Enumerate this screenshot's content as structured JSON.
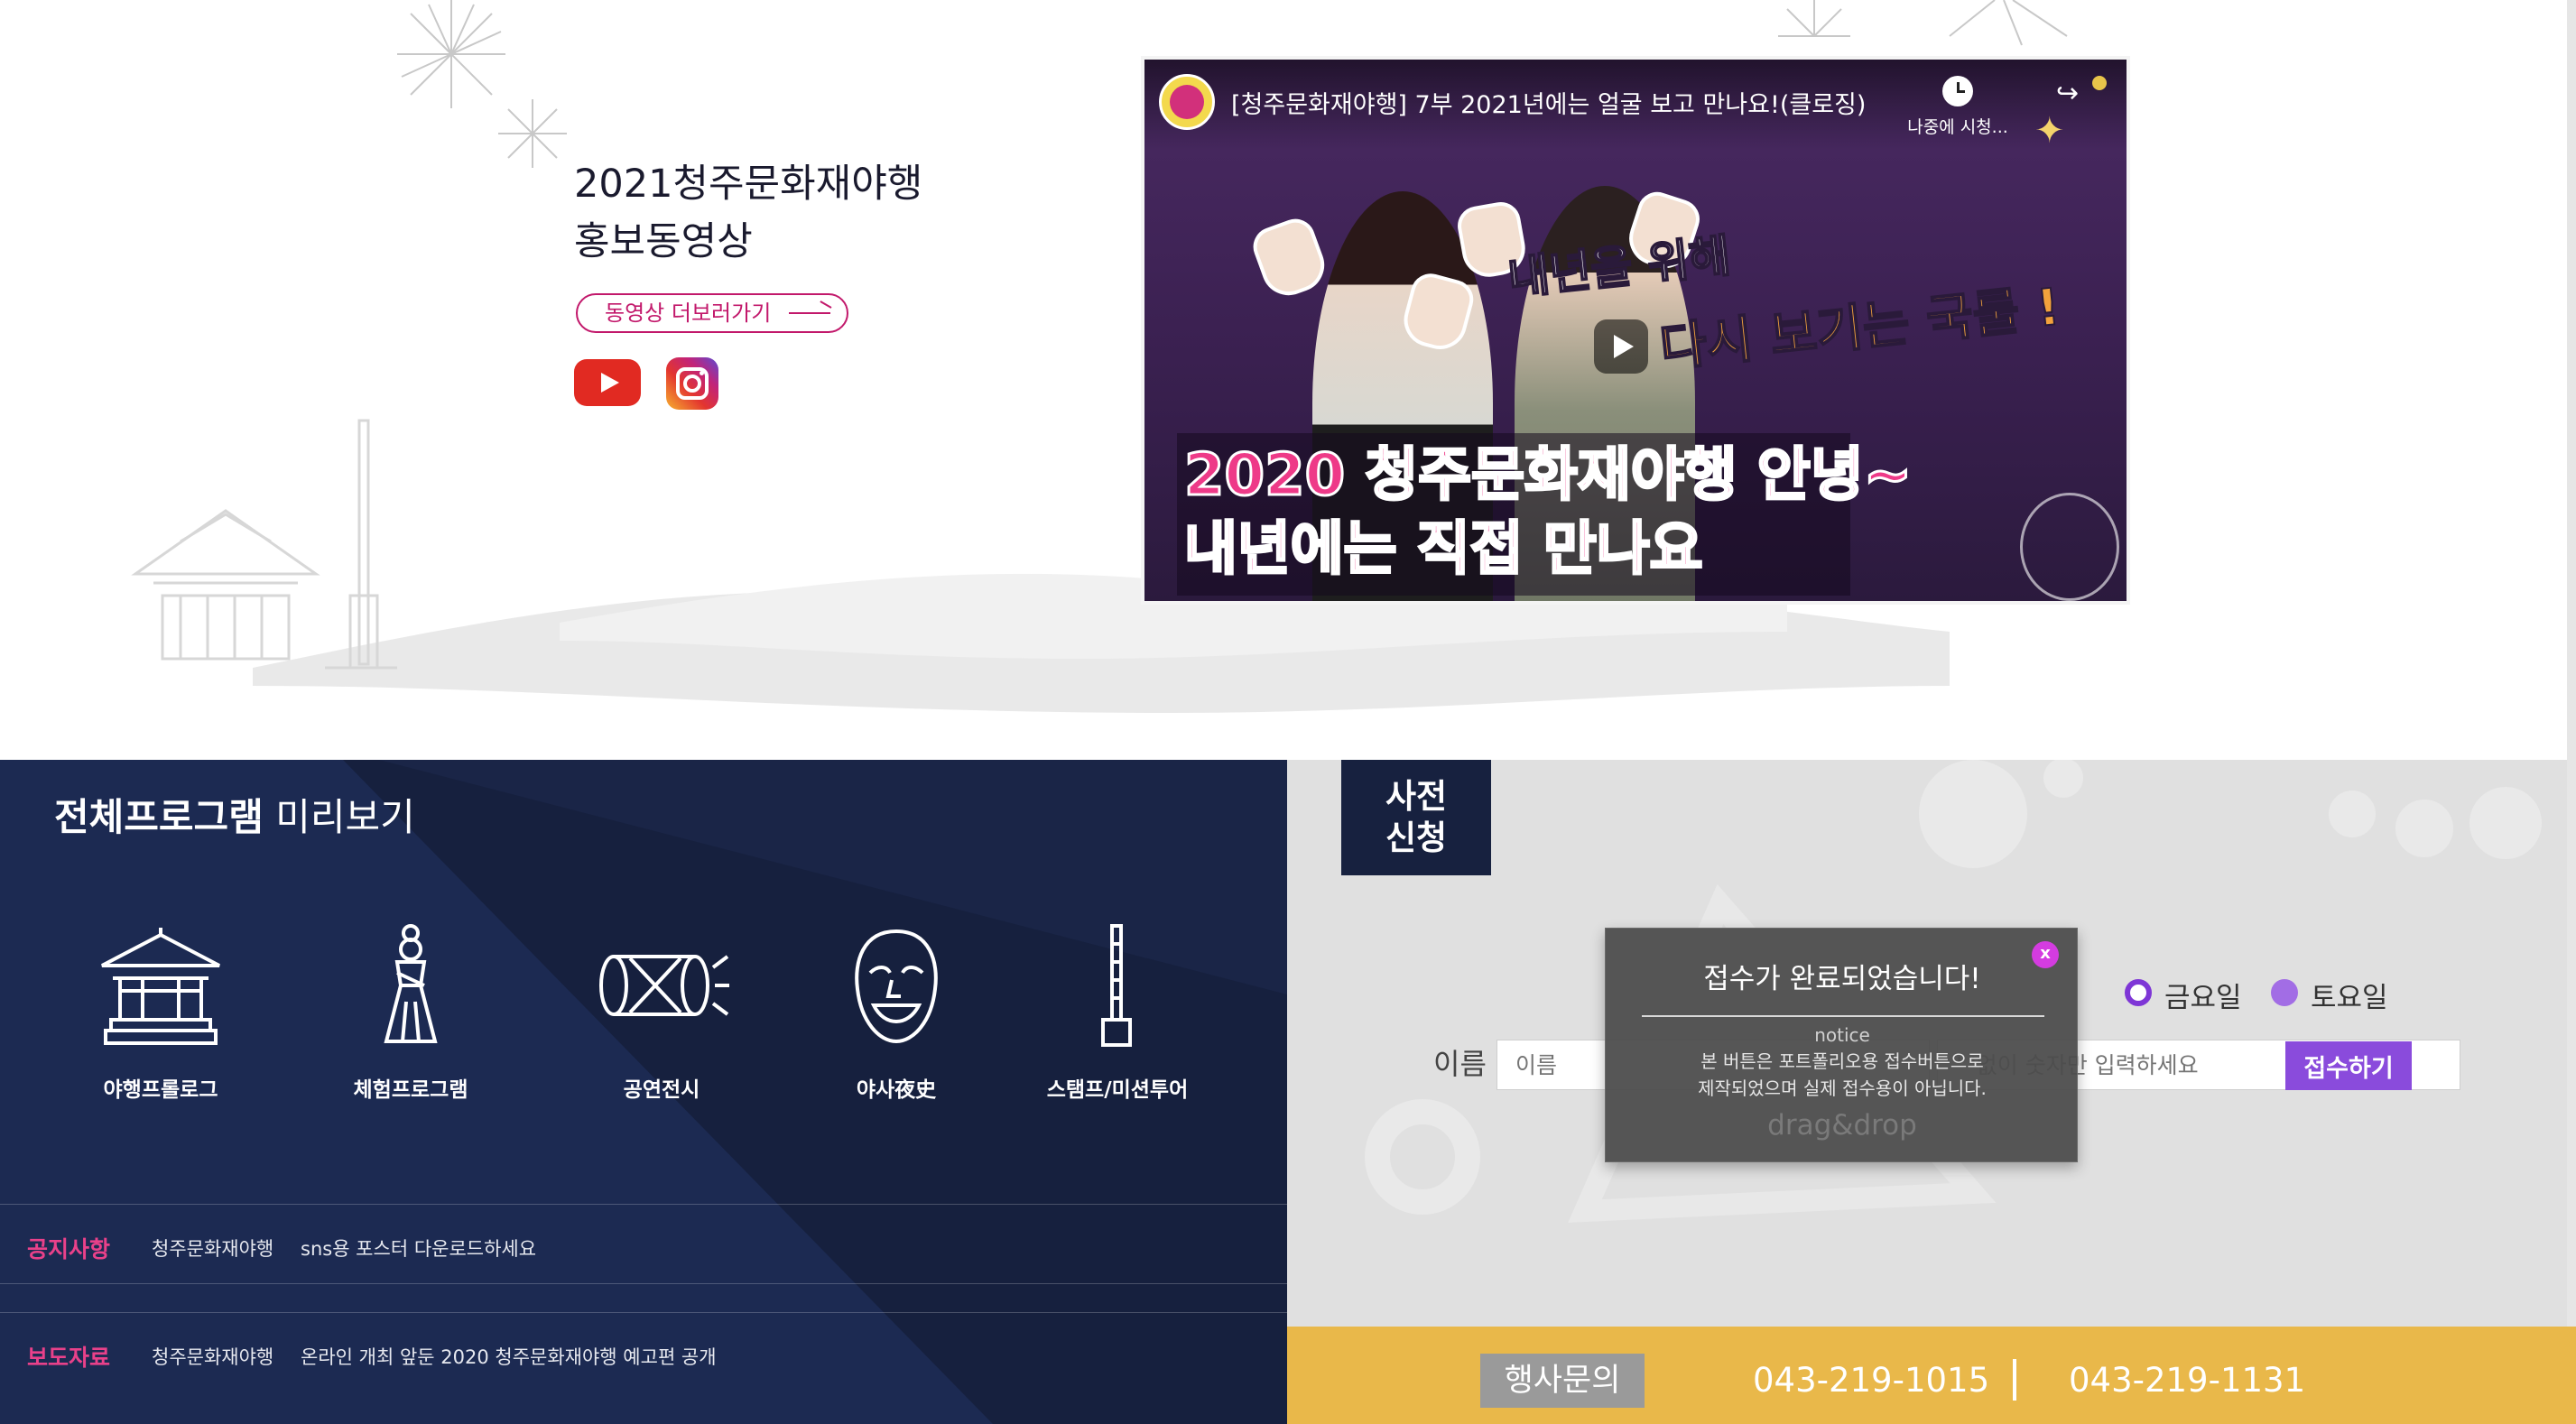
{
  "promo": {
    "title": "2021청주문화재야행\n홍보동영상",
    "more_label": "동영상 더보러가기",
    "youtube_icon": "youtube-icon",
    "instagram_icon": "instagram-icon"
  },
  "video": {
    "title": "[청주문화재야행] 7부 2021년에는 얼굴 보고 만나요!(클로징)",
    "watch_later": "나중에 시청...",
    "caption_line1": "내년을 위해",
    "caption_line2": "다시 보기는 국룰 !",
    "caption_line3": "2020 청주문화재야행 안녕~",
    "caption_line4": "내년에는 직접 만나요"
  },
  "programs": {
    "title_bold": "전체프로그램",
    "title_light": " 미리보기",
    "items": [
      {
        "label": "야행프롤로그",
        "icon": "pavilion-icon"
      },
      {
        "label": "체험프로그램",
        "icon": "hanbok-figure-icon"
      },
      {
        "label": "공연전시",
        "icon": "drum-icon"
      },
      {
        "label": "야사夜史",
        "icon": "mask-icon"
      },
      {
        "label": "스탬프/미션투어",
        "icon": "iron-flagpole-icon"
      }
    ]
  },
  "news": [
    {
      "category": "공지사항",
      "source": "청주문화재야행",
      "text": "sns용 포스터 다운로드하세요"
    },
    {
      "category": "보도자료",
      "source": "청주문화재야행",
      "text": "온라인 개최 앞둔 2020 청주문화재야행 예고편 공개"
    }
  ],
  "apply": {
    "tag": "사전\n신청",
    "day_options": [
      "금요일",
      "토요일"
    ],
    "name_label": "이름",
    "name_placeholder": "이름",
    "phone_placeholder": "'-'없이 숫자만 입력하세요",
    "submit_label": "접수하기"
  },
  "notice": {
    "title": "접수가 완료되었습니다!",
    "close": "x",
    "subtitle": "notice",
    "body": "본 버튼은 포트폴리오용 접수버튼으로\n제작되었으며 실제 접수용이 아닙니다.",
    "drag": "drag&drop"
  },
  "inquiry": {
    "label": "행사문의",
    "phone_1": "043-219-1015",
    "phone_2": "043-219-1131"
  },
  "colors": {
    "navy": "#16203e",
    "pink": "#e9418a",
    "purple": "#8a4bdc",
    "gold": "#e9b84a"
  }
}
